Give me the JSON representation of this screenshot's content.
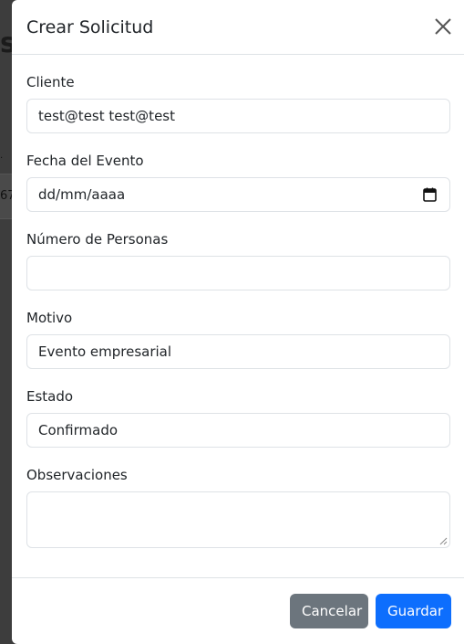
{
  "modal": {
    "title": "Crear Solicitud",
    "fields": {
      "cliente": {
        "label": "Cliente",
        "value": "test@test test@test"
      },
      "fecha": {
        "label": "Fecha del Evento",
        "placeholder": "dd/mm/aaaa"
      },
      "personas": {
        "label": "Número de Personas",
        "value": ""
      },
      "motivo": {
        "label": "Motivo",
        "value": "Evento empresarial"
      },
      "estado": {
        "label": "Estado",
        "value": "Confirmado"
      },
      "observaciones": {
        "label": "Observaciones",
        "value": ""
      }
    },
    "footer": {
      "cancel_label": "Cancelar",
      "save_label": "Guardar"
    }
  },
  "background": {
    "title_fragment": "s",
    "row_fragment": "67",
    "dot_fragment": "."
  }
}
